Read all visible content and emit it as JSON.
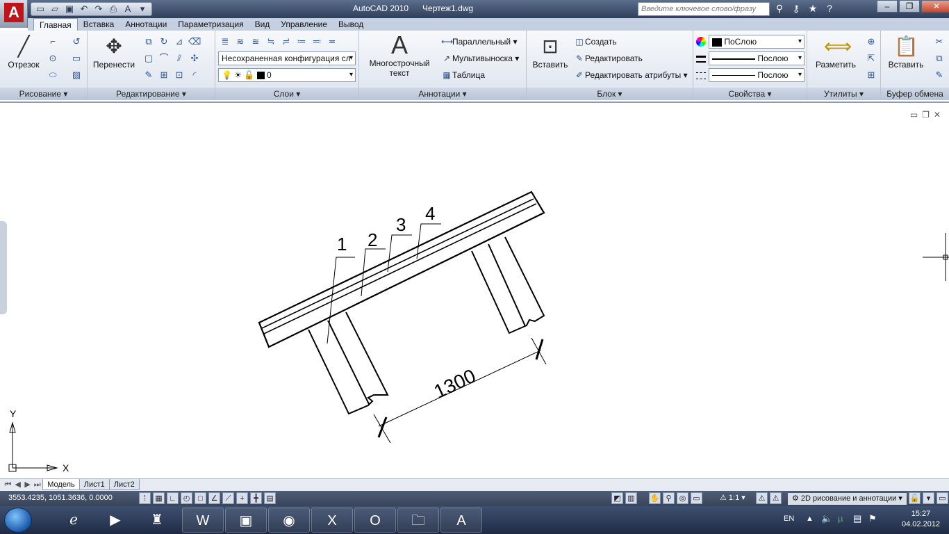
{
  "app": {
    "title": "AutoCAD 2010      Чертеж1.dwg",
    "logo_letter": "A",
    "search_placeholder": "Введите ключевое слово/фразу"
  },
  "qat_icons": [
    "new-icon",
    "open-icon",
    "save-icon",
    "undo-icon",
    "redo-icon",
    "plot-icon",
    "text-icon",
    "dropdown-icon"
  ],
  "tabs": [
    "Главная",
    "Вставка",
    "Аннотации",
    "Параметризация",
    "Вид",
    "Управление",
    "Вывод"
  ],
  "panels": {
    "draw": {
      "title": "Рисование",
      "line_label": "Отрезок"
    },
    "modify": {
      "title": "Редактирование",
      "move_label": "Перенести"
    },
    "layers": {
      "title": "Слои",
      "layer_state": "Несохраненная конфигурация сл",
      "current_layer": "0"
    },
    "annotation": {
      "title": "Аннотации",
      "mtext_label_1": "Многострочный",
      "mtext_label_2": "текст",
      "linear": "Параллельный",
      "multileader": "Мультивыноска",
      "table": "Таблица"
    },
    "block": {
      "title": "Блок",
      "insert_label": "Вставить",
      "create": "Создать",
      "edit": "Редактировать",
      "edit_attr": "Редактировать атрибуты"
    },
    "properties": {
      "title": "Свойства",
      "color": "ПоСлою",
      "lineweight": "Послою",
      "linetype": "Послою"
    },
    "utilities": {
      "title": "Утилиты",
      "measure_label": "Разметить"
    },
    "clipboard": {
      "title": "Буфер обмена",
      "paste_label": "Вставить"
    }
  },
  "drawing": {
    "labels": [
      "1",
      "2",
      "3",
      "4"
    ],
    "dimension": "1300",
    "ucs_x": "X",
    "ucs_y": "Y"
  },
  "layout_tabs": [
    "Модель",
    "Лист1",
    "Лист2"
  ],
  "status": {
    "coords": "3553.4235, 1051.3636, 0.0000",
    "scale": "1:1",
    "workspace": "2D рисование и аннотации"
  },
  "tray": {
    "lang": "EN",
    "time": "15:27",
    "date": "04.02.2012"
  }
}
